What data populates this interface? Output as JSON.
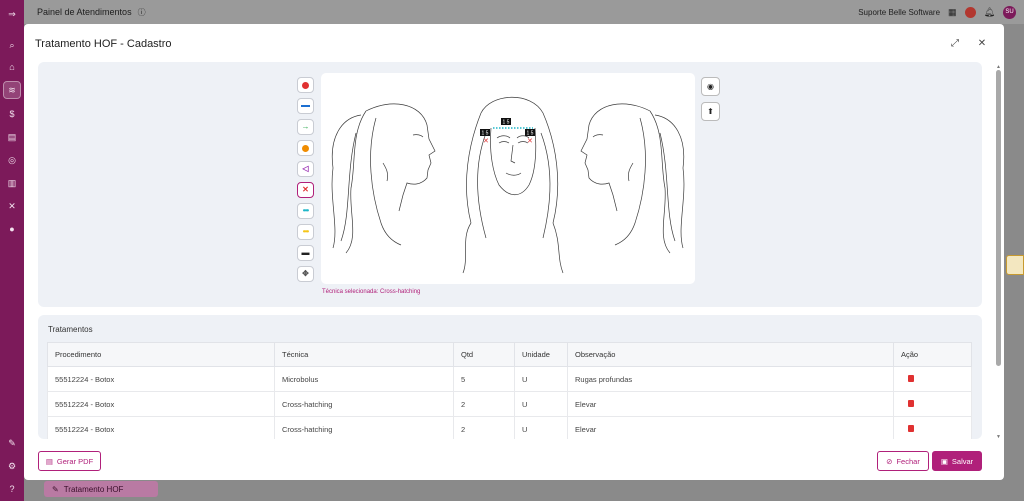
{
  "topbar": {
    "app_title": "Painel de Atendimentos",
    "help_icon": "help-circle-icon",
    "company": "Suporte Belle Software",
    "avatar_initials": "SU"
  },
  "background_tab": {
    "label": "Tratamento HOF"
  },
  "modal": {
    "title": "Tratamento HOF - Cadastro",
    "tools": [
      {
        "icon": "red-dot-icon",
        "color": "#e03131"
      },
      {
        "icon": "blue-line-icon",
        "color": "#1c6fd1"
      },
      {
        "icon": "green-arrow-icon",
        "color": "#2aa84a"
      },
      {
        "icon": "orange-dot-icon",
        "color": "#f08c00"
      },
      {
        "icon": "purple-fan-icon",
        "color": "#9c36b5"
      },
      {
        "icon": "red-x-icon",
        "color": "#e03131"
      },
      {
        "icon": "teal-dotted-line-icon",
        "color": "#1fb7c9"
      },
      {
        "icon": "yellow-dotted-line-icon",
        "color": "#f5c518"
      },
      {
        "icon": "black-dashed-line-icon",
        "color": "#222222"
      },
      {
        "icon": "move-icon",
        "color": "#555555"
      }
    ],
    "canvas_labels": [
      "1 5",
      "1 5",
      "1 5"
    ],
    "selected_technique": "Técnica selecionada: Cross-hatching",
    "treatments": {
      "title": "Tratamentos",
      "columns": [
        "Procedimento",
        "Técnica",
        "Qtd",
        "Unidade",
        "Observação",
        "Ação"
      ],
      "rows": [
        {
          "procedimento": "55512224 - Botox",
          "tecnica": "Microbolus",
          "qtd": "5",
          "unidade": "U",
          "observacao": "Rugas profundas"
        },
        {
          "procedimento": "55512224 - Botox",
          "tecnica": "Cross-hatching",
          "qtd": "2",
          "unidade": "U",
          "observacao": "Elevar"
        },
        {
          "procedimento": "55512224 - Botox",
          "tecnica": "Cross-hatching",
          "qtd": "2",
          "unidade": "U",
          "observacao": "Elevar"
        }
      ]
    },
    "footer": {
      "pdf_label": "Gerar PDF",
      "close_label": "Fechar",
      "save_label": "Salvar"
    }
  },
  "colors": {
    "brand": "#7c1a5a",
    "accent": "#b0207a",
    "danger": "#e03131"
  }
}
